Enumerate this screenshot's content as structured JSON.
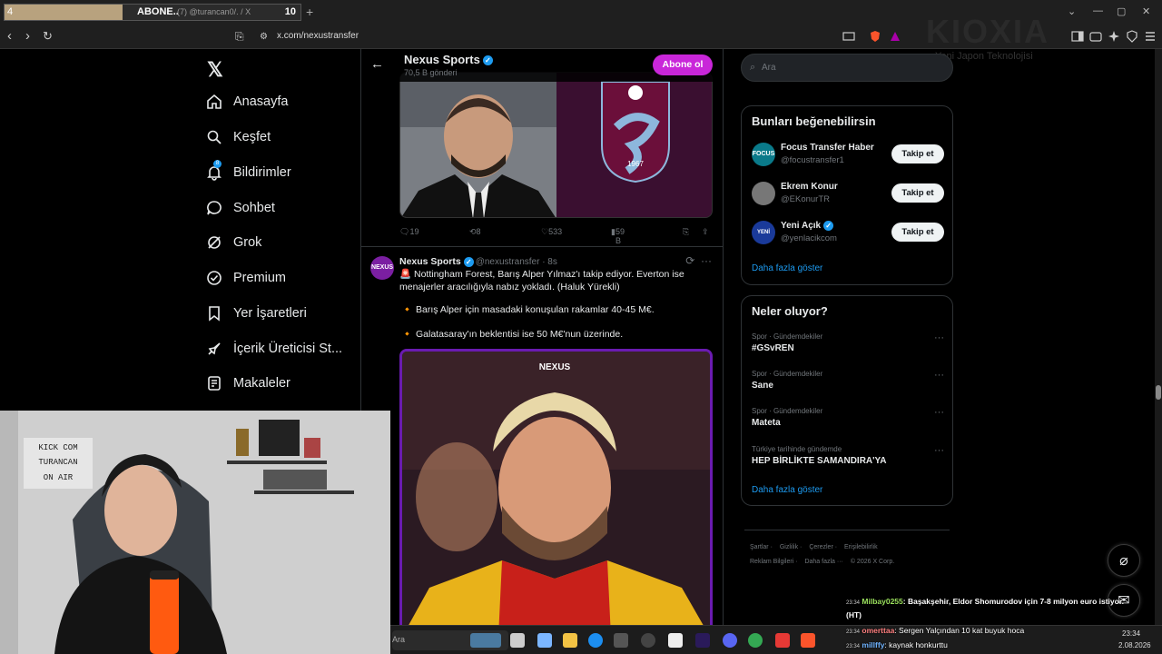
{
  "browser": {
    "tab_number": "4",
    "tab_title": "ABONE..",
    "tab_subtitle": "(7) @turancan0/. / X",
    "tab_count": "10",
    "url": "x.com/nexustransfer"
  },
  "overlay": {
    "brand": "KIOXIA",
    "brand_sub": "Yeni Japon Teknolojisi"
  },
  "sidebar": {
    "items": [
      {
        "label": "Anasayfa"
      },
      {
        "label": "Keşfet"
      },
      {
        "label": "Bildirimler",
        "badge": "8"
      },
      {
        "label": "Sohbet"
      },
      {
        "label": "Grok"
      },
      {
        "label": "Premium"
      },
      {
        "label": "Yer İşaretleri"
      },
      {
        "label": "İçerik Üreticisi St..."
      },
      {
        "label": "Makaleler"
      }
    ]
  },
  "profile_header": {
    "name": "Nexus Sports",
    "posts": "70,5 B gönderi",
    "subscribe": "Abone ol"
  },
  "tweet1": {
    "replies": "19",
    "retweets": "8",
    "likes": "533",
    "views": "59 B",
    "image_caption": "1967"
  },
  "tweet2": {
    "name": "Nexus Sports",
    "handle": "@nexustransfer · 8s",
    "avatar_text": "NEXUS",
    "line1": "🚨 Nottingham Forest, Barış Alper Yılmaz'ı takip ediyor. Everton ise menajerler aracılığıyla nabız yokladı. (Haluk Yürekli)",
    "line2": "🔸 Barış Alper için masadaki konuşulan rakamlar 40-45 M€.",
    "line3": "🔸 Galatasaray'ın beklentisi ise 50 M€'nun üzerinde.",
    "image_label": "NEXUS"
  },
  "right": {
    "search_placeholder": "Ara",
    "suggest_title": "Bunları beğenebilirsin",
    "suggestions": [
      {
        "name": "Focus Transfer Haber",
        "handle": "@focustransfer1",
        "button": "Takip et",
        "verified": false
      },
      {
        "name": "Ekrem Konur",
        "handle": "@EKonurTR",
        "button": "Takip et",
        "verified": false
      },
      {
        "name": "Yeni Açık",
        "handle": "@yenlacikcom",
        "button": "Takip et",
        "verified": true
      }
    ],
    "show_more": "Daha fazla göster",
    "trends_title": "Neler oluyor?",
    "trends": [
      {
        "category": "Spor · Gündemdekiler",
        "title": "#GSvREN"
      },
      {
        "category": "Spor · Gündemdekiler",
        "title": "Sane"
      },
      {
        "category": "Spor · Gündemdekiler",
        "title": "Mateta"
      },
      {
        "category": "Türkiye tarihinde gündemde",
        "title": "HEP BİRLİKTE SAMANDIRA'YA"
      }
    ],
    "trends_more": "Daha fazla göster",
    "footer_line1": [
      "Şartlar",
      "Gizlilik",
      "Çerezler",
      "Erişilebilirlik"
    ],
    "footer_line2": [
      "Reklam Bilgileri",
      "Daha fazla ···",
      "© 2026 X Corp."
    ]
  },
  "webcam": {
    "sign_line1": "KICK COM",
    "sign_line2": "TURANCAN",
    "sign_line3": "ON AIR"
  },
  "chat": [
    {
      "time": "23:34",
      "user": "Milbay0255",
      "text": ": Başakşehir, Eldor Shomurodov için 7-8 milyon euro istiyor.",
      "user_color": "#9be15d"
    },
    {
      "time": "",
      "user": "",
      "text": "(HT)",
      "user_color": "#ffffff"
    },
    {
      "time": "23:34",
      "user": "omerttaa",
      "text": ": Sergen Yalçından 10 kat buyuk hoca",
      "user_color": "#ff7f7f"
    },
    {
      "time": "23:34",
      "user": "millffy",
      "text": ": kaynak honkurttu",
      "user_color": "#6fb3ff"
    }
  ],
  "taskbar": {
    "search": "Ara",
    "time": "23:34",
    "date": "2.08.2026"
  },
  "colors": {
    "accent": "#1d9bf0",
    "subscribe": "#c926d9",
    "background": "#000000"
  }
}
